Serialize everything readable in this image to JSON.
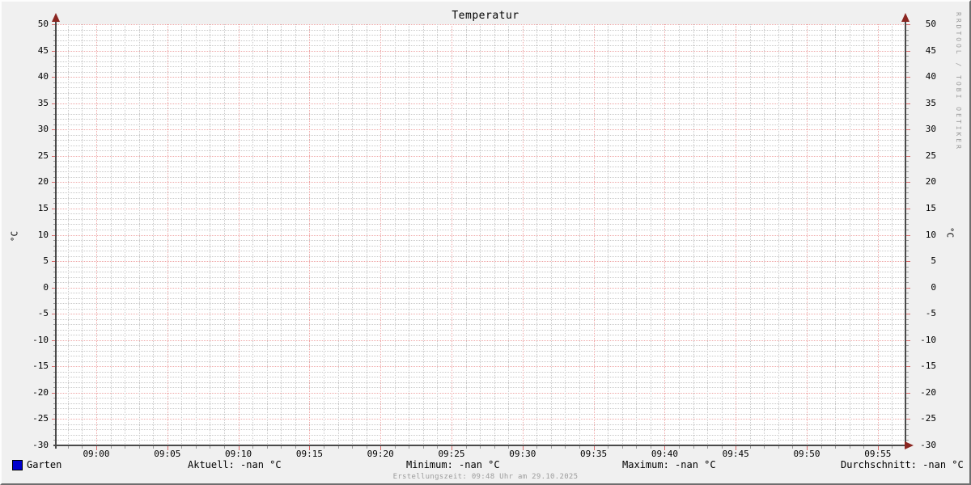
{
  "window": {
    "title": "Temperatur"
  },
  "watermark": "RRDTOOL / TOBI OETIKER",
  "footer": {
    "created": "Erstellungszeit: 09:48 Uhr am 29.10.2025"
  },
  "legend": {
    "series_label": "Garten",
    "stats": [
      "Aktuell: -nan °C",
      "Minimum: -nan °C",
      "Maximum: -nan °C",
      "Durchschnitt: -nan °C"
    ]
  },
  "chart_data": {
    "type": "line",
    "title": "Temperatur",
    "xlabel": "",
    "ylabel": "°C",
    "ylabel_right": "°C",
    "ylim": [
      -30,
      50
    ],
    "y_tick_step": 5,
    "y_minor_step": 1,
    "x_minor_step_minutes": 1,
    "x_ticks": [
      "09:00",
      "09:05",
      "09:10",
      "09:15",
      "09:20",
      "09:25",
      "09:30",
      "09:35",
      "09:40",
      "09:45",
      "09:50",
      "09:55"
    ],
    "y_ticks": [
      "50",
      "45",
      "40",
      "35",
      "30",
      "25",
      "20",
      "15",
      "10",
      "5",
      "0",
      "-5",
      "-10",
      "-15",
      "-20",
      "-25",
      "-30"
    ],
    "series": [
      {
        "name": "Garten",
        "color": "#0000cc",
        "values": []
      }
    ],
    "stats": {
      "aktuell": "-nan °C",
      "minimum": "-nan °C",
      "maximum": "-nan °C",
      "durchschnitt": "-nan °C"
    },
    "grid": {
      "major_color": "#efa7a7",
      "minor_color": "#c8c8c8",
      "grid_on": true
    },
    "axis_color": "#4a4a4a",
    "arrow_color": "#8b2621",
    "legend_position": "bottom"
  }
}
